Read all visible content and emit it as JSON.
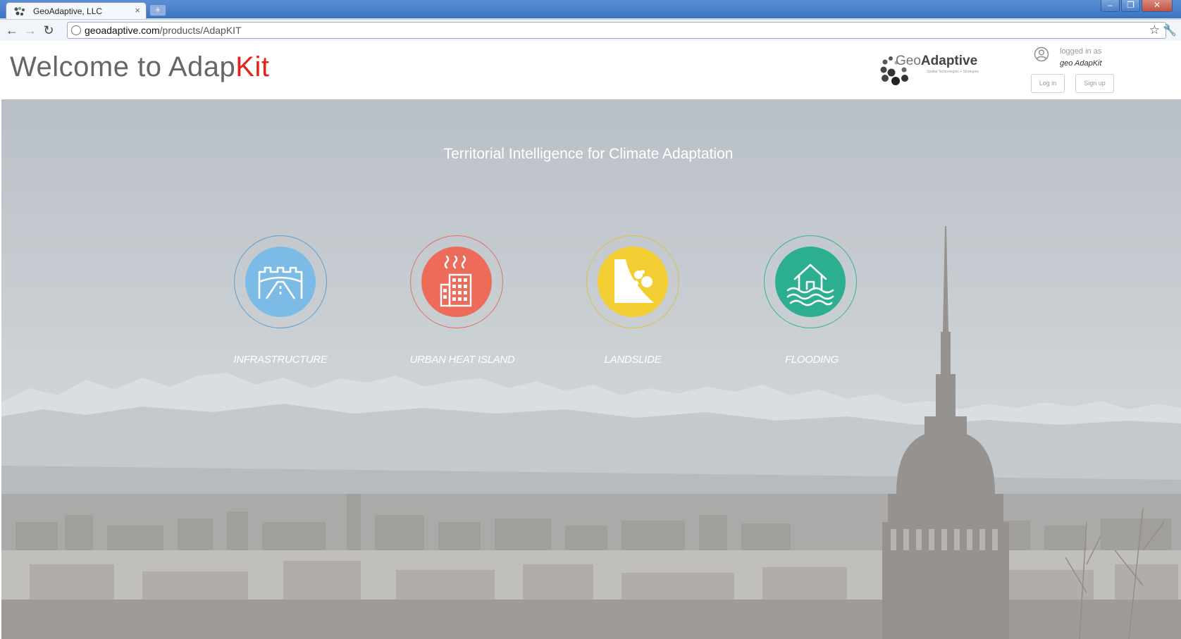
{
  "browser": {
    "tab_title": "GeoAdaptive, LLC",
    "tab_close": "×",
    "new_tab": "+",
    "window_controls": {
      "minimize": "–",
      "restore": "❐",
      "close": "✕"
    },
    "nav": {
      "back": "←",
      "forward": "→",
      "reload": "↻"
    },
    "url_domain": "geoadaptive.com",
    "url_path": "/products/AdapKIT",
    "star_icon": "☆",
    "wrench_icon": "🔧"
  },
  "header": {
    "welcome_prefix": "Welcome to Adap",
    "welcome_accent": "Kit",
    "brand": {
      "name_prefix": "Geo",
      "name_main": "Adaptive",
      "tagline": "Spatial Technologies + Strategies"
    },
    "user": {
      "logged_label": "logged in as",
      "username": "geo AdapKit"
    },
    "login_label": "Log in",
    "signup_label": "Sign up"
  },
  "hero": {
    "tagline": "Territorial Intelligence for Climate Adaptation",
    "categories": [
      {
        "label": "INFRASTRUCTURE",
        "icon": "road-bridge-icon",
        "color": "#7bbbe6"
      },
      {
        "label": "URBAN HEAT ISLAND",
        "icon": "heat-building-icon",
        "color": "#ec6b5a"
      },
      {
        "label": "LANDSLIDE",
        "icon": "landslide-icon",
        "color": "#f3ce33"
      },
      {
        "label": "FLOODING",
        "icon": "flooded-house-icon",
        "color": "#2cae90"
      }
    ]
  },
  "colors": {
    "accent_red": "#e3231b",
    "title_gray": "#666666"
  }
}
